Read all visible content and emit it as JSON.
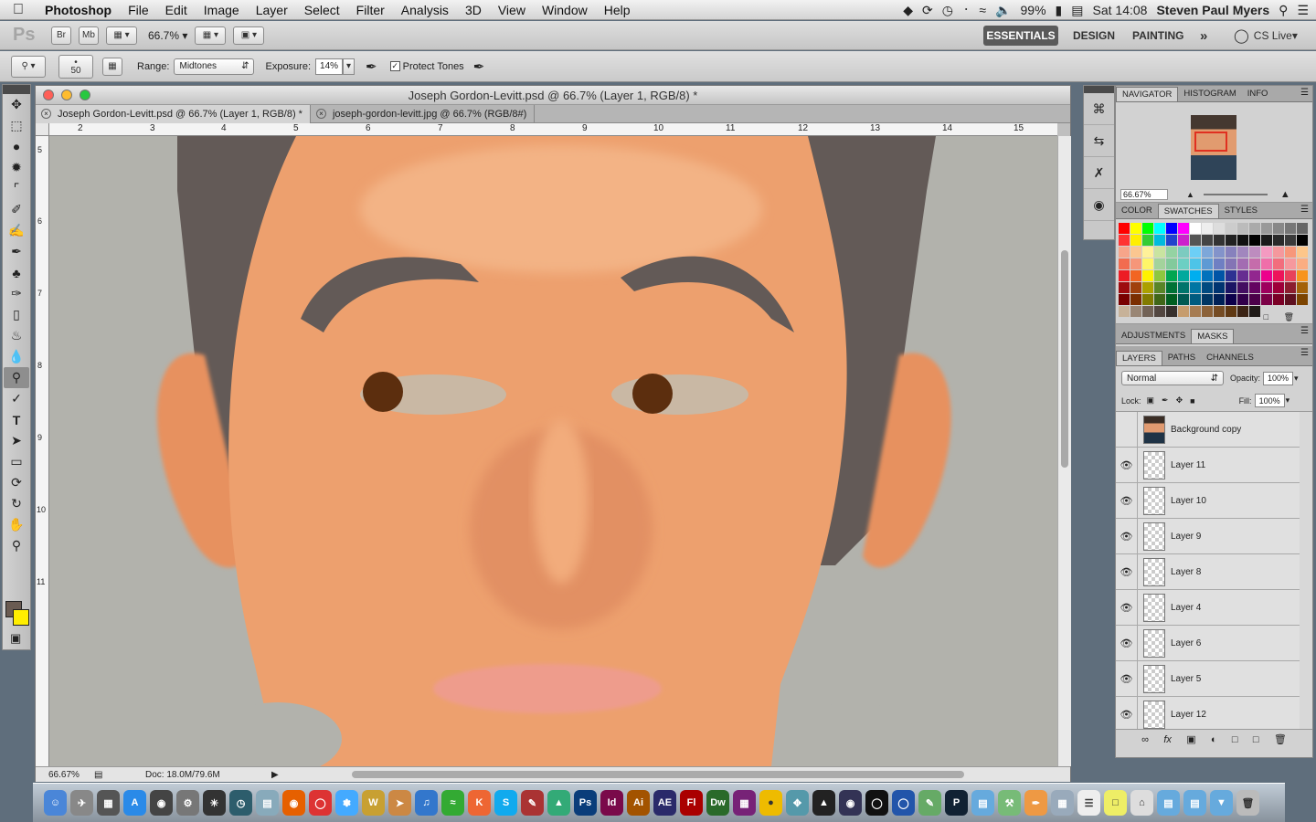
{
  "menubar": {
    "apple": "",
    "app_name": "Photoshop",
    "items": [
      "File",
      "Edit",
      "Image",
      "Layer",
      "Select",
      "Filter",
      "Analysis",
      "3D",
      "View",
      "Window",
      "Help"
    ],
    "battery": "99%",
    "clock": "Sat 14:08",
    "user": "Steven Paul Myers"
  },
  "options_bar": {
    "zoom": "66.7%",
    "workspaces": [
      "ESSENTIALS",
      "DESIGN",
      "PAINTING"
    ],
    "more": "»",
    "cs_live": "CS Live",
    "brush_size": "50",
    "range_label": "Range:",
    "range_value": "Midtones",
    "exposure_label": "Exposure:",
    "exposure_value": "14%",
    "protect_tones": "Protect Tones"
  },
  "document": {
    "title": "Joseph Gordon-Levitt.psd @ 66.7% (Layer 1, RGB/8) *",
    "tabs": [
      "Joseph Gordon-Levitt.psd @ 66.7% (Layer 1, RGB/8) *",
      "joseph-gordon-levitt.jpg @ 66.7% (RGB/8#)"
    ],
    "ruler_h": [
      "2",
      "3",
      "4",
      "5",
      "6",
      "7",
      "8",
      "9",
      "10",
      "11",
      "12",
      "13",
      "14",
      "15"
    ],
    "ruler_v": [
      "5",
      "6",
      "7",
      "8",
      "9",
      "10",
      "11"
    ],
    "status_zoom": "66.67%",
    "status_doc": "Doc: 18.0M/79.6M"
  },
  "navigator": {
    "tabs": [
      "NAVIGATOR",
      "HISTOGRAM",
      "INFO"
    ],
    "zoom": "66.67%"
  },
  "swatch_panel": {
    "tabs": [
      "COLOR",
      "SWATCHES",
      "STYLES"
    ],
    "colors": [
      "#ff0000",
      "#ffff00",
      "#00ff00",
      "#00ffff",
      "#0000ff",
      "#ff00ff",
      "#ffffff",
      "#eeeeee",
      "#dddddd",
      "#cccccc",
      "#bbbbbb",
      "#aaaaaa",
      "#999999",
      "#888888",
      "#777777",
      "#666666",
      "#ff3333",
      "#ffee00",
      "#33cc33",
      "#00bbdd",
      "#2244cc",
      "#cc22cc",
      "#555555",
      "#444444",
      "#333333",
      "#222222",
      "#111111",
      "#000000",
      "#1a1a1a",
      "#2a2a2a",
      "#3a3a3a",
      "#000000",
      "#f7a58a",
      "#fbc690",
      "#fff199",
      "#c9e4a0",
      "#94d3a2",
      "#7ccbc0",
      "#6dcff6",
      "#7da7d9",
      "#8393ca",
      "#8781bd",
      "#a186be",
      "#bd8cbf",
      "#f49ac1",
      "#f5989d",
      "#f7977a",
      "#fdc68a",
      "#f26c4f",
      "#f69679",
      "#fff568",
      "#a3d39c",
      "#82ca9c",
      "#6ccfc3",
      "#4dc4e8",
      "#5e9ad4",
      "#6f7fc3",
      "#8474b5",
      "#a36cb2",
      "#c56cab",
      "#f06ea9",
      "#f26d7d",
      "#f6989d",
      "#fbad82",
      "#ed1c24",
      "#f26522",
      "#fff200",
      "#8dc73f",
      "#00a651",
      "#00a99d",
      "#00aeef",
      "#0072bc",
      "#0054a6",
      "#2e3192",
      "#662d91",
      "#92278f",
      "#ec008c",
      "#ed145b",
      "#e8425b",
      "#f7941d",
      "#9e0b0f",
      "#a0410d",
      "#aba000",
      "#598527",
      "#007236",
      "#00746b",
      "#0076a3",
      "#004a80",
      "#003471",
      "#1b1464",
      "#440e62",
      "#630460",
      "#9e005d",
      "#9e0039",
      "#8b1d2f",
      "#a36209",
      "#790000",
      "#7b2e00",
      "#827b00",
      "#406618",
      "#005e20",
      "#005952",
      "#005b7f",
      "#003663",
      "#002157",
      "#0d004c",
      "#32004b",
      "#4b0049",
      "#7b0046",
      "#7a0026",
      "#5e1020",
      "#7c4400",
      "#c7b299",
      "#998675",
      "#736357",
      "#534741",
      "#37302d",
      "#c69c6d",
      "#a67c52",
      "#8c6239",
      "#754c24",
      "#603913",
      "#3c2415",
      "#1f1a17"
    ]
  },
  "adjust_panel": {
    "tabs": [
      "ADJUSTMENTS",
      "MASKS"
    ]
  },
  "layers_panel": {
    "tabs": [
      "LAYERS",
      "PATHS",
      "CHANNELS"
    ],
    "blend_mode": "Normal",
    "opacity_label": "Opacity:",
    "opacity": "100%",
    "lock_label": "Lock:",
    "fill_label": "Fill:",
    "fill": "100%",
    "layers": [
      {
        "name": "Background copy",
        "visible": false
      },
      {
        "name": "Layer 11",
        "visible": true
      },
      {
        "name": "Layer 10",
        "visible": true
      },
      {
        "name": "Layer 9",
        "visible": true
      },
      {
        "name": "Layer 8",
        "visible": true
      },
      {
        "name": "Layer 4",
        "visible": true
      },
      {
        "name": "Layer 6",
        "visible": true
      },
      {
        "name": "Layer 5",
        "visible": true
      },
      {
        "name": "Layer 12",
        "visible": true
      }
    ]
  },
  "dock": {
    "labels": [
      "Ps",
      "Id",
      "Ai",
      "AE",
      "Fl",
      "Dw"
    ]
  },
  "colors": {
    "skin": "#eda06e",
    "hair": "#635a57",
    "canvas_bg": "#b2b2ac",
    "foreground": "#6a5b52",
    "background": "#ffee00"
  }
}
